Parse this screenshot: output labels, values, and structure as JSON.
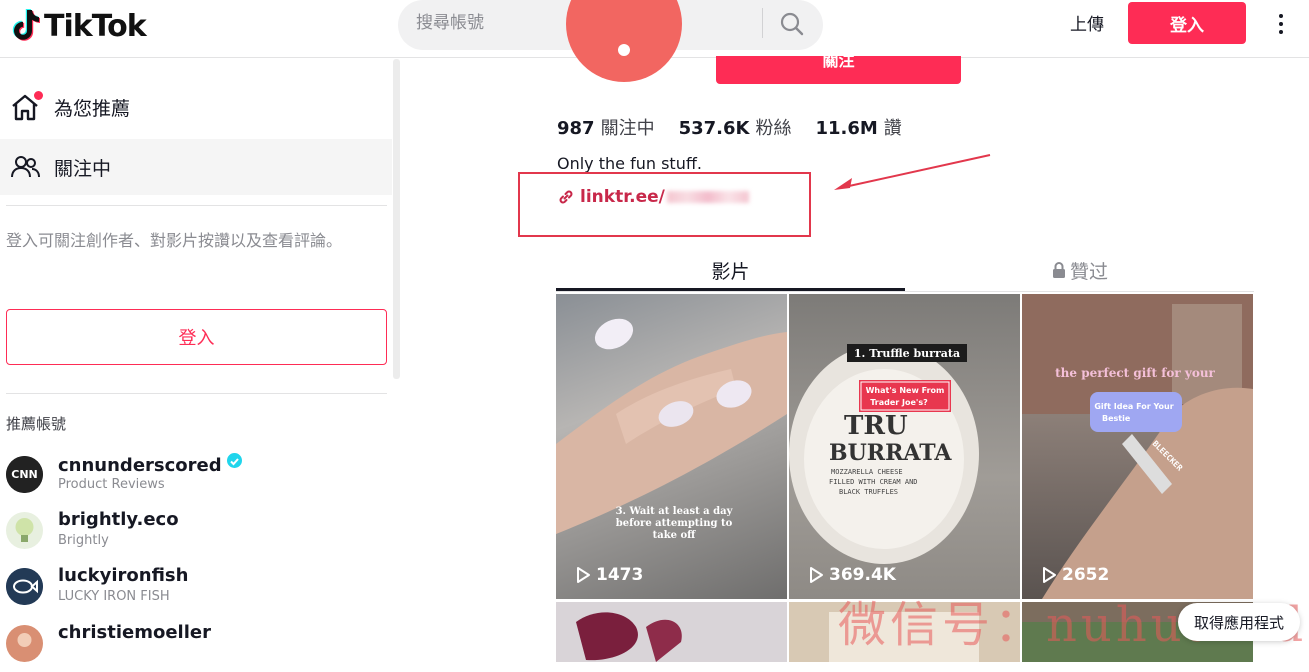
{
  "header": {
    "logo_text": "TikTok",
    "search_placeholder": "搜尋帳號",
    "upload_label": "上傳",
    "login_label": "登入"
  },
  "sidebar": {
    "nav": [
      {
        "label": "為您推薦",
        "icon": "home-icon"
      },
      {
        "label": "關注中",
        "icon": "users-icon"
      }
    ],
    "hint": "登入可關注創作者、對影片按讚以及查看評論。",
    "login_label": "登入",
    "suggested_title": "推薦帳號",
    "accounts": [
      {
        "name": "cnnunderscored",
        "sub": "Product Reviews",
        "verified": true
      },
      {
        "name": "brightly.eco",
        "sub": "Brightly",
        "verified": false
      },
      {
        "name": "luckyironfish",
        "sub": "LUCKY IRON FISH",
        "verified": false
      },
      {
        "name": "christiemoeller",
        "sub": "",
        "verified": false
      }
    ]
  },
  "profile": {
    "follow_label": "關注",
    "stats": [
      {
        "value": "987",
        "label": "關注中"
      },
      {
        "value": "537.6K",
        "label": "粉絲"
      },
      {
        "value": "11.6M",
        "label": "讚"
      }
    ],
    "bio": "Only the fun stuff.",
    "link_text": "linktr.ee/",
    "tabs": [
      "影片",
      "贊过"
    ]
  },
  "videos": [
    {
      "views": "1473",
      "caption": "3. Wait at least a day before attempting to take off"
    },
    {
      "views": "369.4K",
      "caption_top": "1. Truffle burrata",
      "caption_sticker": "What's New From Trader Joe's?",
      "label_lines": [
        "TRU",
        "BURRATA",
        "MOZZARELLA CHEESE",
        "FILLED WITH CREAM AND",
        "BLACK TRUFFLES"
      ]
    },
    {
      "views": "2652",
      "caption_top": "the perfect gift for your",
      "caption_sticker": "Gift Idea For Your Bestie",
      "bracelet": "BLEECKER"
    }
  ],
  "watermark": "微信号：nuhuanidc",
  "get_app_label": "取得應用程式",
  "colors": {
    "accent": "#fe2c55",
    "annotation": "#e2374c"
  }
}
